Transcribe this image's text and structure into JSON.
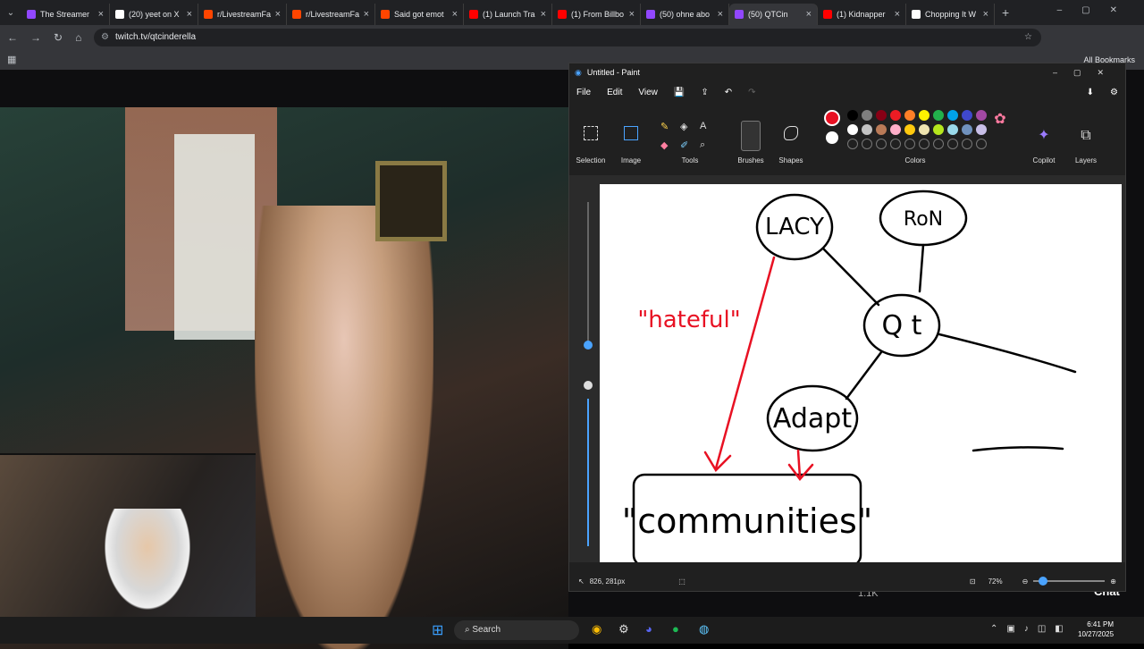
{
  "browser": {
    "tabs": [
      {
        "label": "The Streamer",
        "color": "#9147ff",
        "active": false
      },
      {
        "label": "(20) yeet on X",
        "color": "#ffffff",
        "active": false
      },
      {
        "label": "r/LivestreamFa",
        "color": "#ff4500",
        "active": false
      },
      {
        "label": "r/LivestreamFa",
        "color": "#ff4500",
        "active": false
      },
      {
        "label": "Said got emot",
        "color": "#ff4500",
        "active": false
      },
      {
        "label": "(1) Launch Tra",
        "color": "#ff0000",
        "active": false
      },
      {
        "label": "(1) From Billbo",
        "color": "#ff0000",
        "active": false
      },
      {
        "label": "(50) ohne abo",
        "color": "#9147ff",
        "active": false
      },
      {
        "label": "(50) QTCin",
        "color": "#9147ff",
        "active": true
      },
      {
        "label": "(1) Kidnapper",
        "color": "#ff0000",
        "active": false
      },
      {
        "label": "Chopping It W",
        "color": "#ffffff",
        "active": false
      }
    ],
    "url": "twitch.tv/qtcinderella",
    "bookmarks_label": "All Bookmarks"
  },
  "paint": {
    "window_title": "Untitled - Paint",
    "menu": [
      "File",
      "Edit",
      "View"
    ],
    "groups": {
      "selection": "Selection",
      "image": "Image",
      "tools": "Tools",
      "brushes": "Brushes",
      "shapes": "Shapes",
      "colors": "Colors",
      "copilot": "Copilot",
      "layers": "Layers"
    },
    "palette_row1": [
      "#000000",
      "#7f7f7f",
      "#880015",
      "#ed1c24",
      "#ff7f27",
      "#fff200",
      "#22b14c",
      "#00a2e8",
      "#3f48cc",
      "#a349a4"
    ],
    "palette_row2": [
      "#ffffff",
      "#c3c3c3",
      "#b97a57",
      "#ffaec9",
      "#ffc90e",
      "#efe4b0",
      "#b5e61d",
      "#99d9ea",
      "#7092be",
      "#c8bfe7"
    ],
    "primary_color": "#e81123",
    "secondary_color": "#ffffff",
    "cursor_pos": "826, 281px",
    "zoom": "72%",
    "drawing": {
      "nodes": {
        "lacy": "LACY",
        "ron": "RoN",
        "qt": "Q t",
        "adapt": "Adapt",
        "communities": "\"communities\""
      },
      "annotation": "\"hateful\""
    }
  },
  "overlay": {
    "viewers": "1.1K",
    "chat_label": "Chat"
  },
  "taskbar": {
    "search": "Search",
    "time": "6:41 PM",
    "date": "10/27/2025"
  }
}
